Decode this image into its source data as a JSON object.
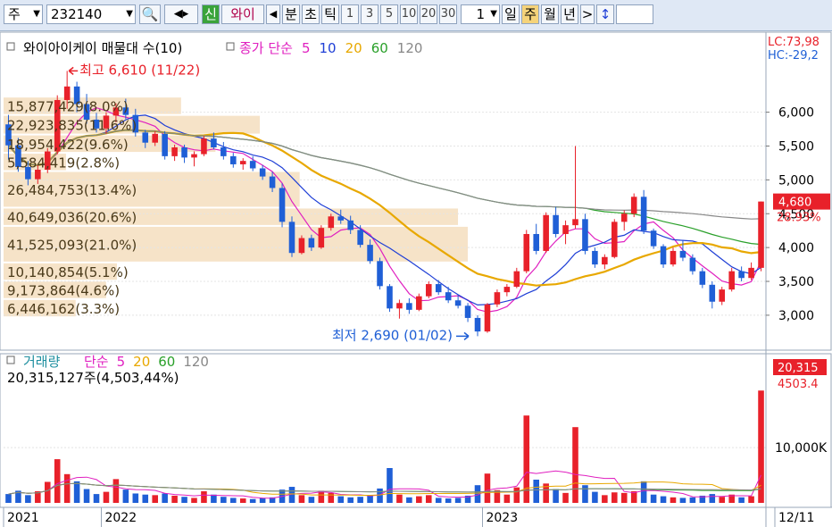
{
  "toolbar": {
    "market_select": "주",
    "code_input": "232140",
    "new_badge": "신",
    "stock_name": "와이",
    "minute_label": "분",
    "second_label": "초",
    "tick_label": "틱",
    "intervals": [
      "1",
      "3",
      "5",
      "10",
      "20",
      "30"
    ],
    "count_value": "1",
    "day_label": "일",
    "week_label": "주",
    "month_label": "월",
    "year_label": "년",
    "next_label": ">"
  },
  "colors": {
    "up": "#e8212a",
    "down": "#1f5fd6",
    "ma5": "#e020c0",
    "ma10": "#1f3fd6",
    "ma20": "#e8a800",
    "ma60": "#2aa02a",
    "ma120": "#888888",
    "volume_profile": "#f6e3c8"
  },
  "chart_data": {
    "type": "candlestick",
    "price_panel": {
      "title": "와이아이케이 매물대 수(10)",
      "legend": [
        {
          "label": "종가 단순",
          "color": "#e020c0"
        },
        {
          "label": "5",
          "color": "#e020c0"
        },
        {
          "label": "10",
          "color": "#1f3fd6"
        },
        {
          "label": "20",
          "color": "#e8a800"
        },
        {
          "label": "60",
          "color": "#2aa02a"
        },
        {
          "label": "120",
          "color": "#888888"
        }
      ],
      "ylim": [
        2550,
        6800
      ],
      "y_ticks": [
        {
          "v": 6000,
          "t": "6,000"
        },
        {
          "v": 5500,
          "t": "5,500"
        },
        {
          "v": 5000,
          "t": "5,000"
        },
        {
          "v": 4500,
          "t": "4,500"
        },
        {
          "v": 4000,
          "t": "4,000"
        },
        {
          "v": 3500,
          "t": "3,500"
        },
        {
          "v": 3000,
          "t": "3,000"
        }
      ],
      "lc_label": "LC:73,98",
      "hc_label": "HC:-29,2",
      "current_price": "4,680",
      "current_change": "28.93%",
      "max_annotation": "최고 6,610 (11/22)",
      "min_annotation": "최저 2,690 (01/02)",
      "high_value": 6610,
      "low_value": 2690,
      "last_close": 4680,
      "profile_bands": [
        {
          "low": 5960,
          "high": 6230,
          "label": "15,877,429(8.0%)",
          "volume": 15877429
        },
        {
          "low": 5670,
          "high": 5960,
          "label": "22,923,835(11.6%)",
          "volume": 22923835
        },
        {
          "low": 5400,
          "high": 5670,
          "label": "18,954,422(9.6%)",
          "volume": 18954422
        },
        {
          "low": 5130,
          "high": 5400,
          "label": "5,584,419(2.8%)",
          "volume": 5584419
        },
        {
          "low": 4590,
          "high": 5130,
          "label": "26,484,753(13.4%)",
          "volume": 26484753
        },
        {
          "low": 4320,
          "high": 4590,
          "label": "40,649,036(20.6%)",
          "volume": 40649036
        },
        {
          "low": 3780,
          "high": 4320,
          "label": "41,525,093(21.0%)",
          "volume": 41525093
        },
        {
          "low": 3510,
          "high": 3780,
          "label": "10,140,854(5.1%)",
          "volume": 10140854
        },
        {
          "low": 3240,
          "high": 3510,
          "label": "9,173,864(4.6%)",
          "volume": 9173864
        },
        {
          "low": 2970,
          "high": 3240,
          "label": "6,446,162(3.3%)",
          "volume": 6446162
        }
      ],
      "candles": [
        [
          5820,
          5960,
          5300,
          5510
        ],
        [
          5510,
          5620,
          5120,
          5190
        ],
        [
          5190,
          5280,
          4920,
          5010
        ],
        [
          5010,
          5220,
          4940,
          5150
        ],
        [
          5150,
          5470,
          5100,
          5420
        ],
        [
          5420,
          6250,
          5380,
          6180
        ],
        [
          6180,
          6610,
          6050,
          6380
        ],
        [
          6380,
          6450,
          6000,
          6120
        ],
        [
          6120,
          6270,
          5830,
          5890
        ],
        [
          5890,
          5990,
          5700,
          5760
        ],
        [
          5760,
          6000,
          5680,
          5950
        ],
        [
          5950,
          6130,
          5850,
          6070
        ],
        [
          6070,
          6200,
          5900,
          5960
        ],
        [
          5960,
          6050,
          5640,
          5700
        ],
        [
          5700,
          5740,
          5470,
          5550
        ],
        [
          5550,
          5720,
          5500,
          5680
        ],
        [
          5680,
          5720,
          5300,
          5350
        ],
        [
          5350,
          5520,
          5280,
          5480
        ],
        [
          5480,
          5520,
          5250,
          5330
        ],
        [
          5330,
          5420,
          5200,
          5380
        ],
        [
          5380,
          5650,
          5350,
          5610
        ],
        [
          5610,
          5700,
          5450,
          5480
        ],
        [
          5480,
          5560,
          5300,
          5350
        ],
        [
          5350,
          5400,
          5180,
          5230
        ],
        [
          5230,
          5320,
          5150,
          5280
        ],
        [
          5280,
          5350,
          5130,
          5170
        ],
        [
          5170,
          5220,
          5000,
          5050
        ],
        [
          5050,
          5120,
          4820,
          4880
        ],
        [
          4880,
          4950,
          4300,
          4380
        ],
        [
          4380,
          4460,
          3860,
          3920
        ],
        [
          3920,
          4180,
          3900,
          4140
        ],
        [
          4140,
          4190,
          3950,
          4000
        ],
        [
          4000,
          4330,
          3980,
          4290
        ],
        [
          4290,
          4500,
          4250,
          4460
        ],
        [
          4460,
          4560,
          4350,
          4400
        ],
        [
          4400,
          4470,
          4200,
          4260
        ],
        [
          4260,
          4330,
          4000,
          4040
        ],
        [
          4040,
          4120,
          3760,
          3800
        ],
        [
          3800,
          3850,
          3380,
          3430
        ],
        [
          3430,
          3460,
          3050,
          3100
        ],
        [
          3100,
          3230,
          2950,
          3180
        ],
        [
          3180,
          3250,
          3020,
          3080
        ],
        [
          3080,
          3320,
          3060,
          3280
        ],
        [
          3280,
          3500,
          3250,
          3460
        ],
        [
          3460,
          3520,
          3300,
          3340
        ],
        [
          3340,
          3420,
          3180,
          3220
        ],
        [
          3220,
          3300,
          3100,
          3140
        ],
        [
          3140,
          3180,
          2900,
          2960
        ],
        [
          2960,
          3000,
          2690,
          2760
        ],
        [
          2760,
          3180,
          2740,
          3160
        ],
        [
          3160,
          3380,
          3120,
          3340
        ],
        [
          3340,
          3460,
          3280,
          3420
        ],
        [
          3420,
          3700,
          3400,
          3650
        ],
        [
          3650,
          4260,
          3620,
          4200
        ],
        [
          4200,
          4350,
          3900,
          3950
        ],
        [
          3950,
          4520,
          3920,
          4480
        ],
        [
          4480,
          4600,
          4150,
          4200
        ],
        [
          4200,
          4400,
          4050,
          4330
        ],
        [
          4330,
          5500,
          4280,
          4420
        ],
        [
          4420,
          4500,
          3900,
          3950
        ],
        [
          3950,
          4000,
          3700,
          3750
        ],
        [
          3750,
          3900,
          3680,
          3860
        ],
        [
          3860,
          4420,
          3840,
          4380
        ],
        [
          4380,
          4550,
          4250,
          4500
        ],
        [
          4500,
          4800,
          4450,
          4750
        ],
        [
          4750,
          4850,
          4200,
          4250
        ],
        [
          4250,
          4280,
          3980,
          4020
        ],
        [
          4020,
          4050,
          3700,
          3750
        ],
        [
          3750,
          4000,
          3720,
          3950
        ],
        [
          3950,
          4100,
          3800,
          3850
        ],
        [
          3850,
          3900,
          3600,
          3650
        ],
        [
          3650,
          3700,
          3400,
          3450
        ],
        [
          3450,
          3500,
          3100,
          3200
        ],
        [
          3200,
          3420,
          3150,
          3380
        ],
        [
          3380,
          3700,
          3350,
          3650
        ],
        [
          3650,
          3720,
          3500,
          3550
        ],
        [
          3550,
          3780,
          3520,
          3700
        ],
        [
          3700,
          4680,
          3650,
          4680
        ]
      ],
      "x_ticks": [
        {
          "i": 0,
          "label": "2021"
        },
        {
          "i": 10,
          "label": "2022"
        },
        {
          "i": 49,
          "label": "2023"
        },
        {
          "i": 78,
          "label": "12/11"
        }
      ]
    },
    "volume_panel": {
      "title": "거래량",
      "legend": [
        {
          "label": "단순",
          "color": "#e020c0"
        },
        {
          "label": "5",
          "color": "#e020c0"
        },
        {
          "label": "20",
          "color": "#e8a800"
        },
        {
          "label": "60",
          "color": "#2aa02a"
        },
        {
          "label": "120",
          "color": "#888888"
        }
      ],
      "info": "20,315,127주(4,503,44%)",
      "last_volume_label": "20,315",
      "last_volume_change": "4503.4",
      "ylim": [
        0,
        21000000
      ],
      "y_ticks": [
        {
          "v": 10000000,
          "t": "10,000K"
        }
      ],
      "volumes": [
        1600000,
        2200000,
        1400000,
        2100000,
        3800000,
        7900000,
        5200000,
        3900000,
        2500000,
        1600000,
        2000000,
        4300000,
        2400000,
        1700000,
        1500000,
        1400000,
        1700000,
        1300000,
        1100000,
        900000,
        2100000,
        1500000,
        1100000,
        900000,
        800000,
        700000,
        900000,
        1000000,
        2400000,
        2900000,
        1400000,
        1100000,
        2200000,
        1800000,
        1200000,
        1000000,
        1100000,
        1300000,
        2600000,
        6300000,
        1500000,
        1000000,
        1200000,
        1400000,
        900000,
        800000,
        900000,
        1300000,
        3200000,
        5300000,
        2300000,
        1500000,
        2800000,
        15800000,
        4200000,
        3500000,
        2500000,
        1800000,
        13700000,
        3200000,
        2000000,
        1400000,
        1900000,
        1800000,
        2100000,
        3900000,
        1500000,
        1200000,
        1000000,
        900000,
        1000000,
        1300000,
        1600000,
        1100000,
        1500000,
        1000000,
        1200000,
        20315127
      ]
    }
  }
}
